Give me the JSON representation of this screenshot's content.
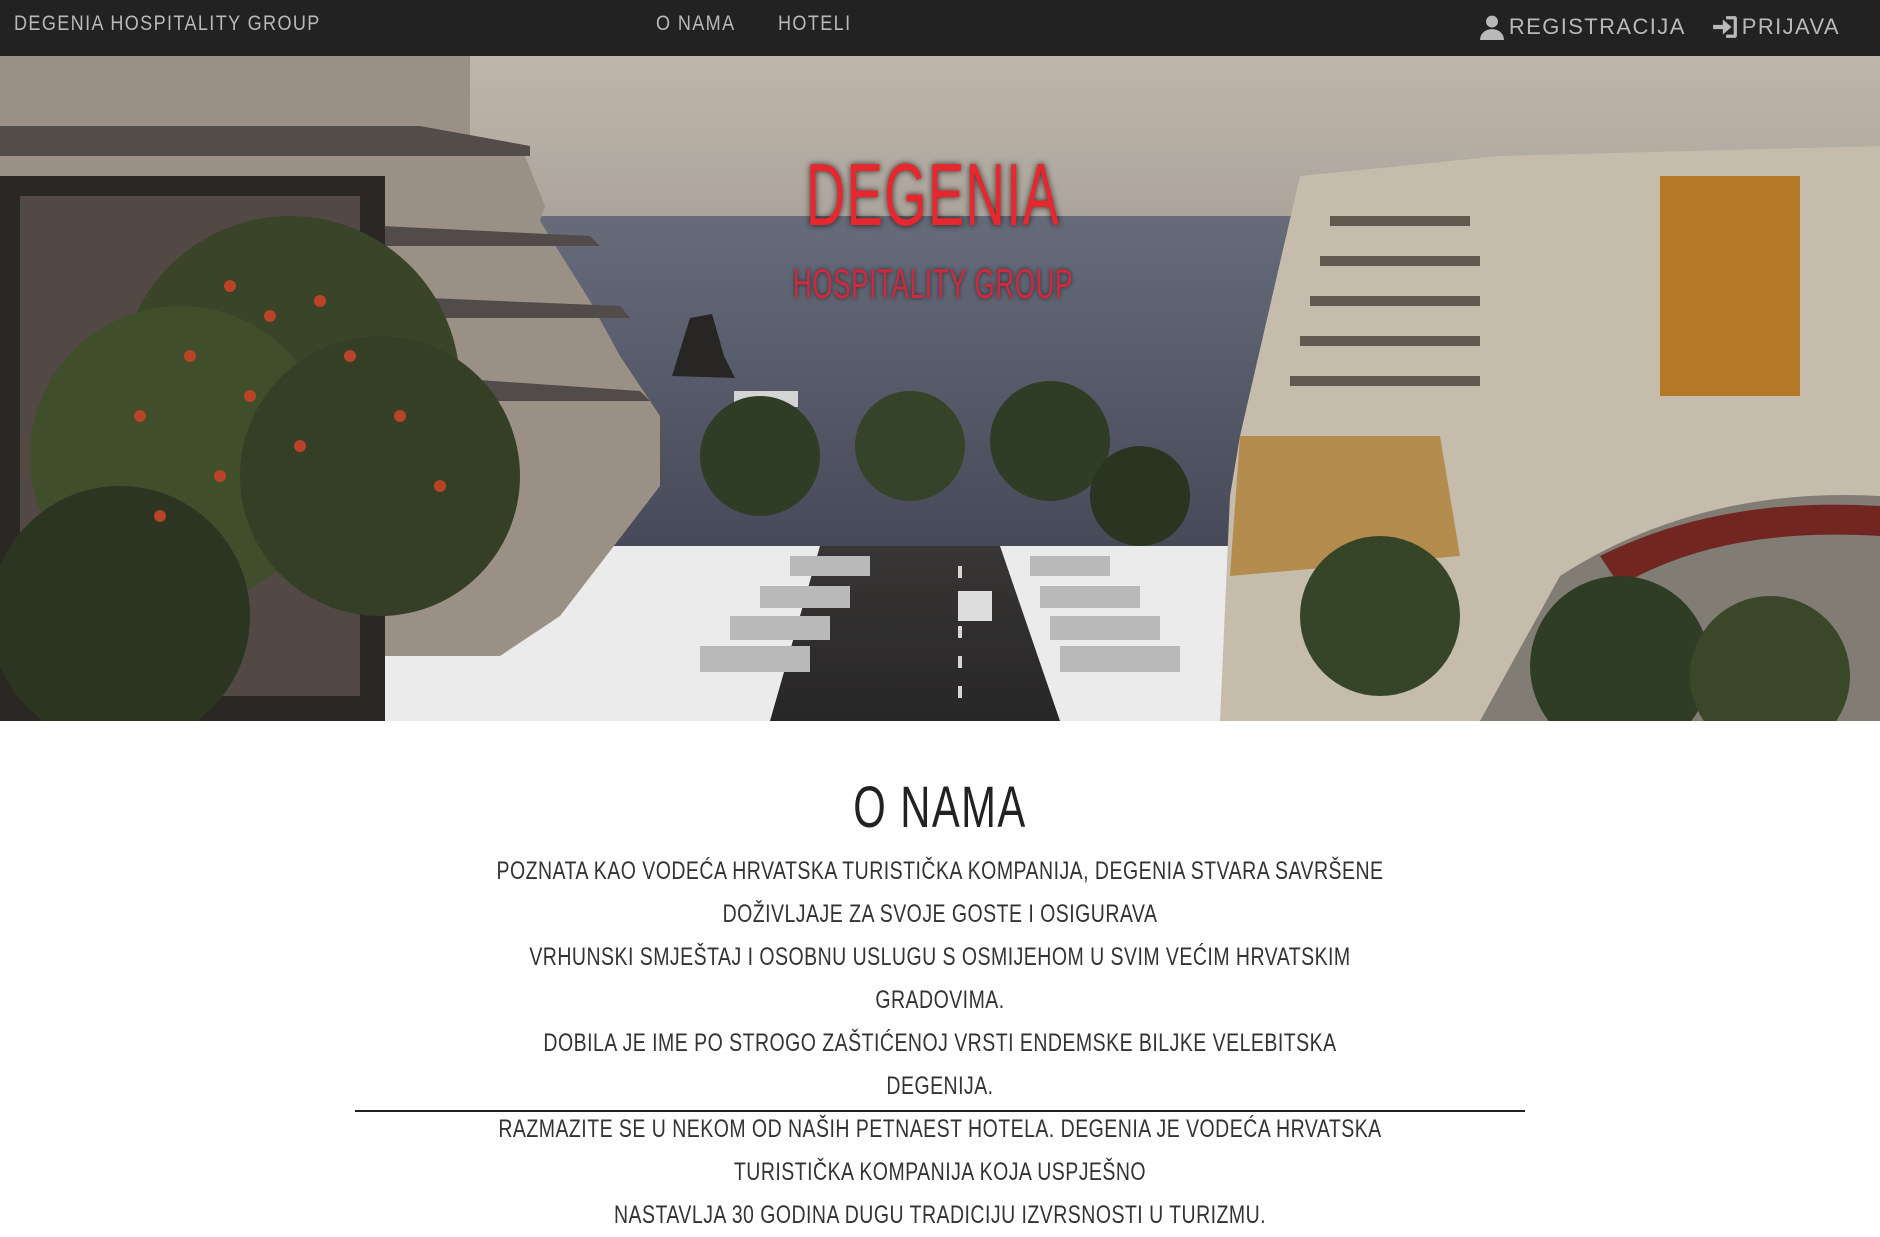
{
  "navbar": {
    "brand": "DEGENIA HOSPITALITY GROUP",
    "links": [
      "O NAMA",
      "HOTELI"
    ],
    "register_label": "REGISTRACIJA",
    "login_label": "PRIJAVA",
    "register_icon": "user-icon",
    "login_icon": "sign-in-icon"
  },
  "hero": {
    "title": "DEGENIA",
    "subtitle": "HOSPITALITY GROUP"
  },
  "about": {
    "heading": "O NAMA",
    "lines": [
      "Poznata kao vodeća hrvatska turistička kompanija, Degenia stvara savršene doživljaje za svoje goste i osigurava",
      "vrhunski smještaj i osobnu uslugu s osmijehom u svim većim hrvatskim gradovima.",
      "Dobila je ime po strogo zaštićenoj vrsti endemske biljke velebitska degenija.",
      "Razmazite se u nekom od naših petnaest hotela. Degenia je vodeća hrvatska turistička kompanija koja uspješno",
      "nastavlja 30 godina dugu tradiciju izvrsnosti u turizmu."
    ]
  },
  "colors": {
    "navbar_bg": "#222222",
    "nav_text": "#b9b9b9",
    "hero_title": "#e8262d",
    "body_text": "#333333"
  }
}
